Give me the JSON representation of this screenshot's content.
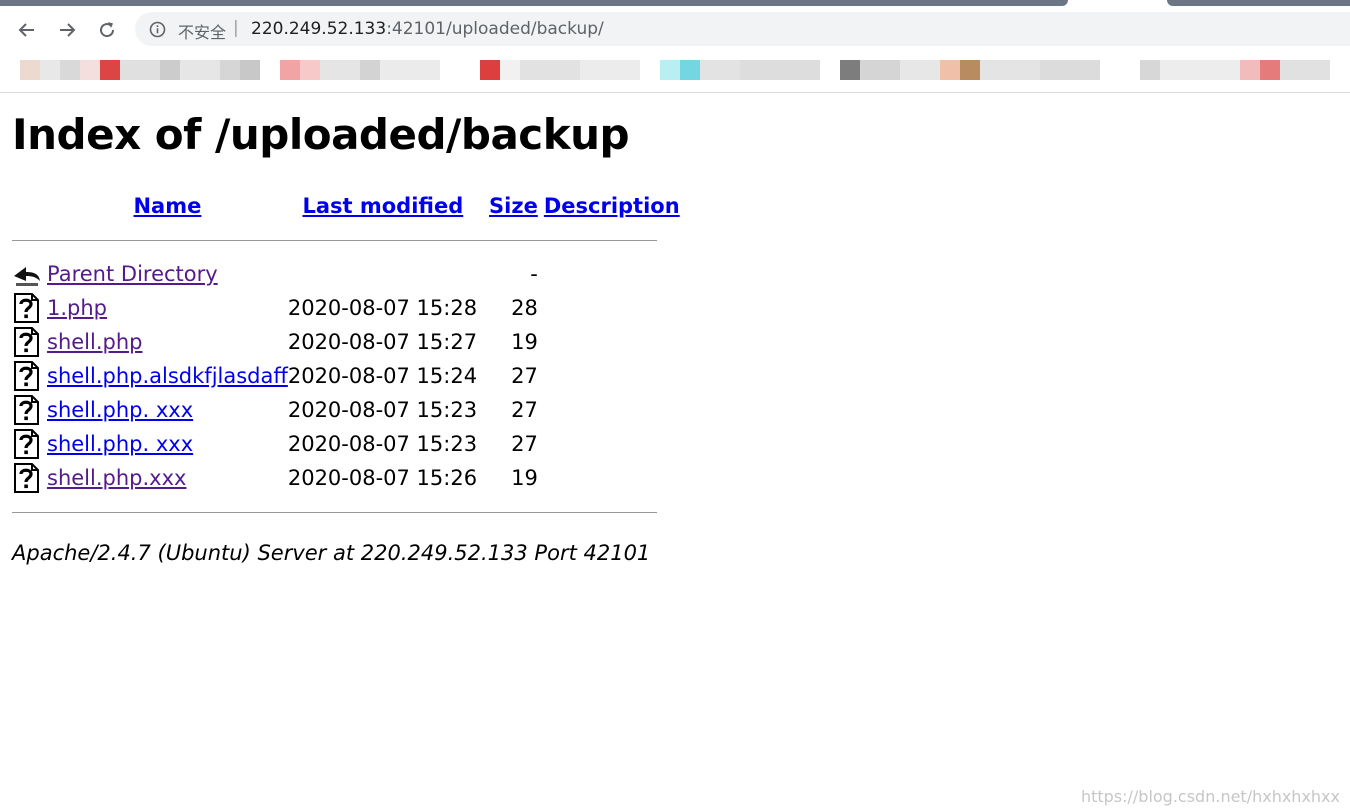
{
  "browser": {
    "security_label": "不安全",
    "separator": "|",
    "url_host": "220.249.52.133",
    "url_rest": ":42101/uploaded/backup/"
  },
  "page": {
    "title": "Index of /uploaded/backup",
    "columns": {
      "name": "Name",
      "last_modified": "Last modified",
      "size": "Size",
      "description": "Description"
    },
    "parent": {
      "name": "Parent Directory",
      "size": "-"
    },
    "files": [
      {
        "name": "1.php",
        "modified": "2020-08-07 15:28",
        "size": "28",
        "visited": true
      },
      {
        "name": "shell.php",
        "modified": "2020-08-07 15:27",
        "size": "19",
        "visited": true
      },
      {
        "name": "shell.php.alsdkfjlasdaff",
        "modified": "2020-08-07 15:24",
        "size": "27",
        "visited": false
      },
      {
        "name": "shell.php. xxx",
        "modified": "2020-08-07 15:23",
        "size": "27",
        "visited": false
      },
      {
        "name": "shell.php. xxx",
        "modified": "2020-08-07 15:23",
        "size": "27",
        "visited": false
      },
      {
        "name": "shell.php.xxx",
        "modified": "2020-08-07 15:26",
        "size": "19",
        "visited": true
      }
    ],
    "footer": "Apache/2.4.7 (Ubuntu) Server at 220.249.52.133 Port 42101"
  },
  "watermark": "https://blog.csdn.net/hxhxhxhxx",
  "icons": {
    "back": "arrow-left-icon",
    "forward": "arrow-right-icon",
    "reload": "reload-icon",
    "info": "info-circle-icon",
    "parent": "back-arrow-folder-icon",
    "file": "unknown-file-icon"
  },
  "colors": {
    "link": "#0000ee",
    "visited_link": "#551a8b",
    "chrome_tab": "#6b7585",
    "omnibox_bg": "#f1f3f4"
  }
}
